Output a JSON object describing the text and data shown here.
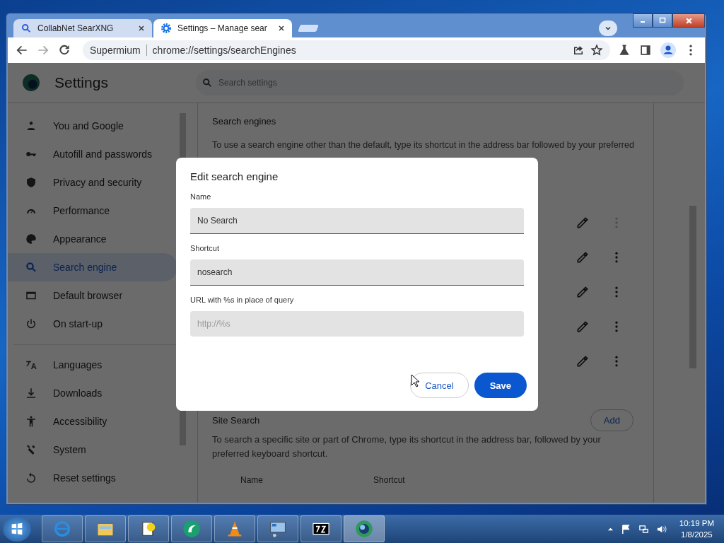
{
  "browser": {
    "tabs": [
      {
        "title": "CollabNet SearXNG",
        "selected": false
      },
      {
        "title": "Settings – Manage sear",
        "selected": true
      }
    ],
    "omnibox": {
      "site": "Supermium",
      "url": "chrome://settings/searchEngines"
    }
  },
  "settings": {
    "title": "Settings",
    "search": {
      "placeholder": "Search settings"
    },
    "nav": [
      {
        "label": "You and Google",
        "selected": false
      },
      {
        "label": "Autofill and passwords",
        "selected": false
      },
      {
        "label": "Privacy and security",
        "selected": false
      },
      {
        "label": "Performance",
        "selected": false
      },
      {
        "label": "Appearance",
        "selected": false
      },
      {
        "label": "Search engine",
        "selected": true
      },
      {
        "label": "Default browser",
        "selected": false
      },
      {
        "label": "On start-up",
        "selected": false
      },
      {
        "label": "Languages",
        "selected": false
      },
      {
        "label": "Downloads",
        "selected": false
      },
      {
        "label": "Accessibility",
        "selected": false
      },
      {
        "label": "System",
        "selected": false
      },
      {
        "label": "Reset settings",
        "selected": false
      }
    ],
    "search_engines": {
      "heading": "Search engines",
      "description": "To use a search engine other than the default, type its shortcut in the address bar followed by your preferred",
      "rows": [
        {
          "more_disabled": true
        },
        {
          "more_disabled": false
        },
        {
          "more_disabled": false
        },
        {
          "more_disabled": false
        },
        {
          "more_disabled": false
        }
      ]
    },
    "site_search": {
      "heading": "Site Search",
      "add_button": "Add",
      "description": "To search a specific site or part of Chrome, type its shortcut in the address bar, followed by your preferred keyboard shortcut.",
      "columns": [
        "Name",
        "Shortcut"
      ]
    }
  },
  "dialog": {
    "title": "Edit search engine",
    "fields": [
      {
        "label": "Name",
        "value": "No Search"
      },
      {
        "label": "Shortcut",
        "value": "nosearch"
      },
      {
        "label": "URL with %s in place of query",
        "placeholder": "http://%s"
      }
    ],
    "cancel": "Cancel",
    "save": "Save"
  },
  "taskbar": {
    "apps": [
      {
        "selected": false
      },
      {
        "selected": false
      },
      {
        "selected": false
      },
      {
        "selected": false
      },
      {
        "selected": false
      },
      {
        "selected": false
      },
      {
        "selected": false
      },
      {
        "selected": true
      }
    ],
    "time": "10:19 PM",
    "date": "1/8/2025"
  }
}
